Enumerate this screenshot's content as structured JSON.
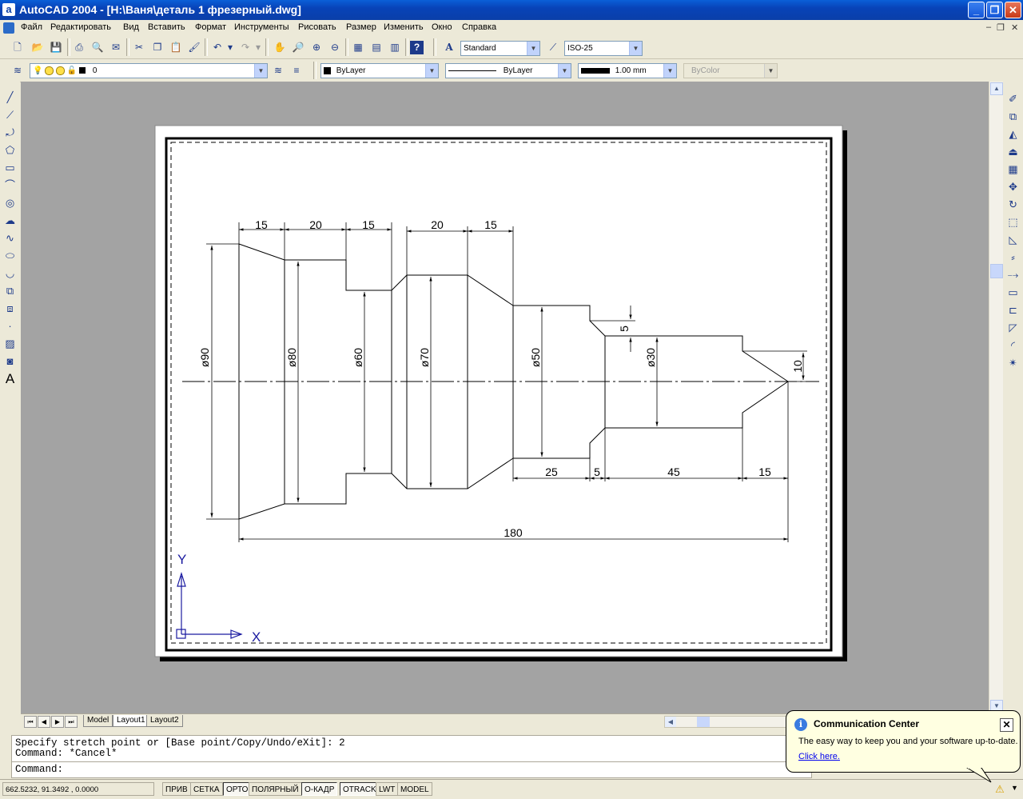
{
  "window": {
    "app_icon": "a",
    "title": "AutoCAD 2004 - [H:\\Ваня\\деталь 1 фрезерный.dwg]",
    "minimize": "_",
    "maximize": "❐",
    "close": "✕",
    "doc_min": "–",
    "doc_restore": "❐",
    "doc_close": "✕"
  },
  "menu": [
    {
      "label": "Файл"
    },
    {
      "label": "Редактировать"
    },
    {
      "label": "Вид"
    },
    {
      "label": "Вставить"
    },
    {
      "label": "Формат"
    },
    {
      "label": "Инструменты"
    },
    {
      "label": "Рисовать"
    },
    {
      "label": "Размер"
    },
    {
      "label": "Изменить"
    },
    {
      "label": "Окно"
    },
    {
      "label": "Справка"
    }
  ],
  "toolbar": {
    "text_style": "Standard",
    "dim_style": "ISO-25",
    "layer": "0",
    "color": "ByLayer",
    "linetype": "ByLayer",
    "lineweight": "1.00 mm",
    "plotstyle": "ByColor"
  },
  "drawing": {
    "dims_top": [
      "15",
      "20",
      "15",
      "20",
      "15"
    ],
    "diameters": [
      "ø90",
      "ø80",
      "ø60",
      "ø70",
      "ø50",
      "ø30"
    ],
    "dims_bottom": [
      "25",
      "5",
      "45",
      "15"
    ],
    "chamfer": "5",
    "tip": "10",
    "overall": "180",
    "ucs_y": "Y",
    "ucs_x": "X"
  },
  "tabs": {
    "model": "Model",
    "layout1": "Layout1",
    "layout2": "Layout2"
  },
  "command": {
    "line1": "Specify stretch point or [Base point/Copy/Undo/eXit]: 2",
    "line2": "Command: *Cancel*",
    "prompt": "Command:"
  },
  "status": {
    "coords": "662.5232, 91.3492 , 0.0000",
    "snap": "ПРИВ",
    "grid": "СЕТКА",
    "ortho": "ОРТО",
    "polar": "ПОЛЯРНЫЙ",
    "osnap": "О-КАДР",
    "otrack": "OTRACK",
    "lwt": "LWT",
    "model": "MODEL"
  },
  "balloon": {
    "title": "Communication Center",
    "text": "The easy way to keep you and your software up-to-date.",
    "link": "Click here."
  }
}
